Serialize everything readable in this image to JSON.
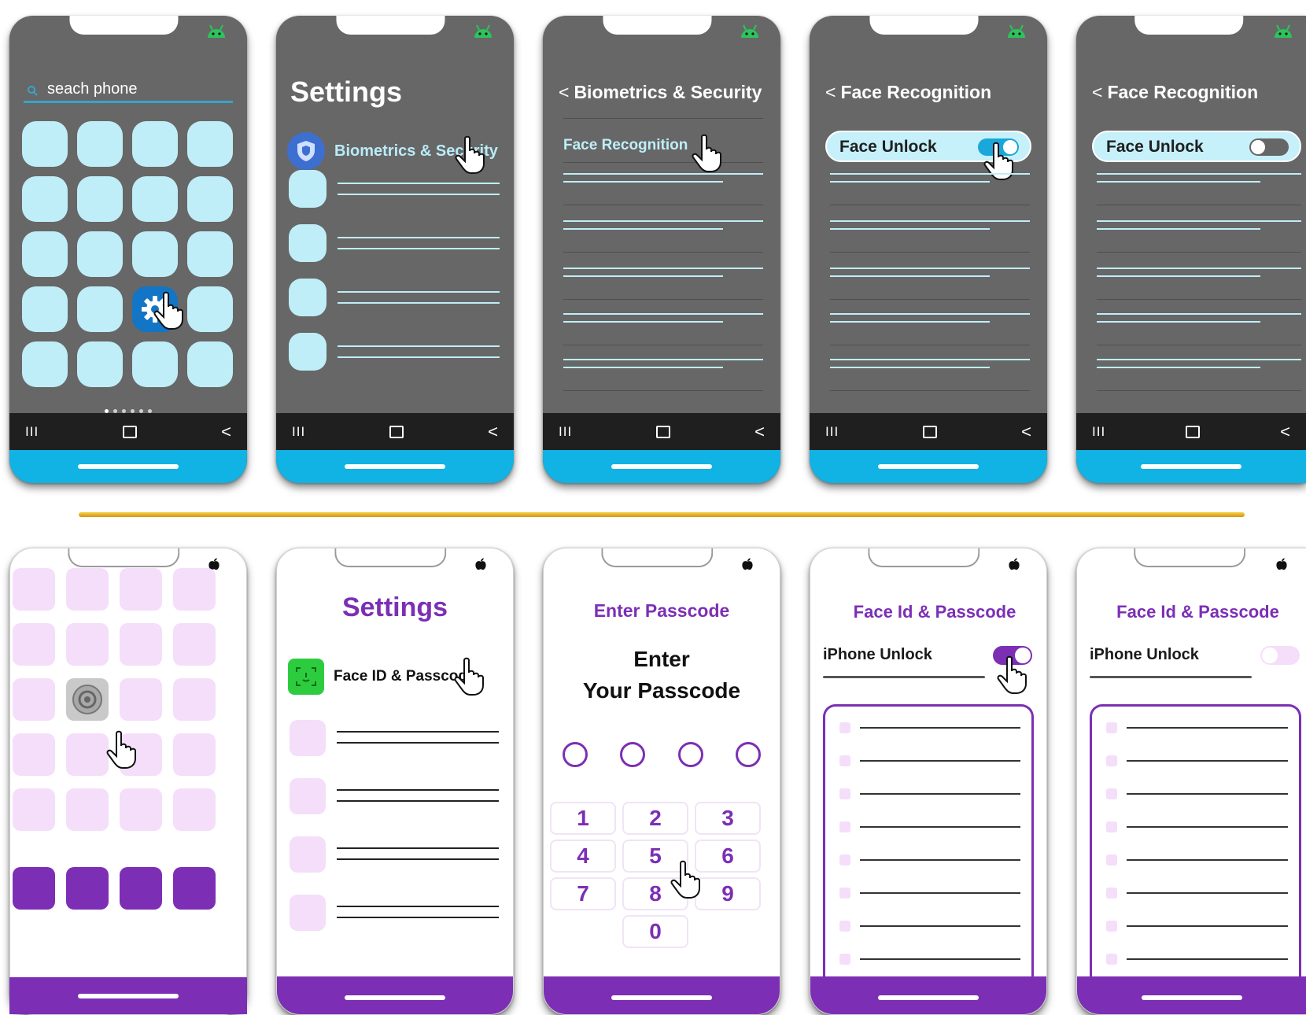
{
  "colors": {
    "android_body": "#676767",
    "android_accent": "#10b3e3",
    "android_tile": "#bfeef8",
    "ios_accent": "#7c2fb5",
    "ios_tile": "#f4defa",
    "divider": "#e8b52a"
  },
  "android": {
    "home": {
      "search_placeholder": "seach phone",
      "icon": "android-icon"
    },
    "settings": {
      "title": "Settings",
      "item_label": "Biometrics & Security",
      "item_icon": "shield-icon"
    },
    "biometrics": {
      "header": "Biometrics & Security",
      "item_label": "Face Recognition"
    },
    "face_recognition_on": {
      "header": "Face Recognition",
      "toggle_label": "Face Unlock",
      "toggle_state": "on"
    },
    "face_recognition_off": {
      "header": "Face Recognition",
      "toggle_label": "Face Unlock",
      "toggle_state": "off"
    },
    "nav": {
      "recents": "III",
      "back": "<"
    }
  },
  "ios": {
    "home": {
      "icon": "apple-icon"
    },
    "settings": {
      "title": "Settings",
      "item_label": "Face ID & Passcode"
    },
    "passcode": {
      "header": "Enter Passcode",
      "heading_line1": "Enter",
      "heading_line2": "Your Passcode",
      "keys": [
        "1",
        "2",
        "3",
        "4",
        "5",
        "6",
        "7",
        "8",
        "9",
        "0"
      ]
    },
    "faceid_on": {
      "header": "Face Id & Passcode",
      "toggle_label": "iPhone Unlock",
      "toggle_state": "on"
    },
    "faceid_off": {
      "header": "Face Id & Passcode",
      "toggle_label": "iPhone Unlock",
      "toggle_state": "off"
    }
  }
}
